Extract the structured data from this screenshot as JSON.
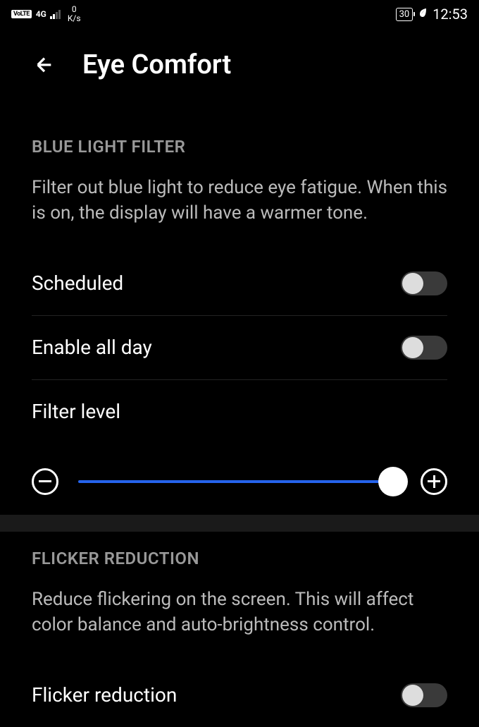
{
  "status_bar": {
    "volte": "VoLTE",
    "network": "4G",
    "speed_value": "0",
    "speed_unit": "K/s",
    "battery": "30",
    "time": "12:53"
  },
  "header": {
    "title": "Eye Comfort"
  },
  "sections": {
    "blue_light": {
      "heading": "BLUE LIGHT FILTER",
      "description": "Filter out blue light to reduce eye fatigue. When this is on, the display will have a warmer tone.",
      "scheduled": {
        "label": "Scheduled",
        "enabled": false
      },
      "enable_all_day": {
        "label": "Enable all day",
        "enabled": false
      },
      "filter_level": {
        "label": "Filter level",
        "value": 95
      }
    },
    "flicker": {
      "heading": "FLICKER REDUCTION",
      "description": "Reduce flickering on the screen. This will affect color balance and auto-brightness control.",
      "flicker_reduction": {
        "label": "Flicker reduction",
        "enabled": false
      }
    }
  }
}
